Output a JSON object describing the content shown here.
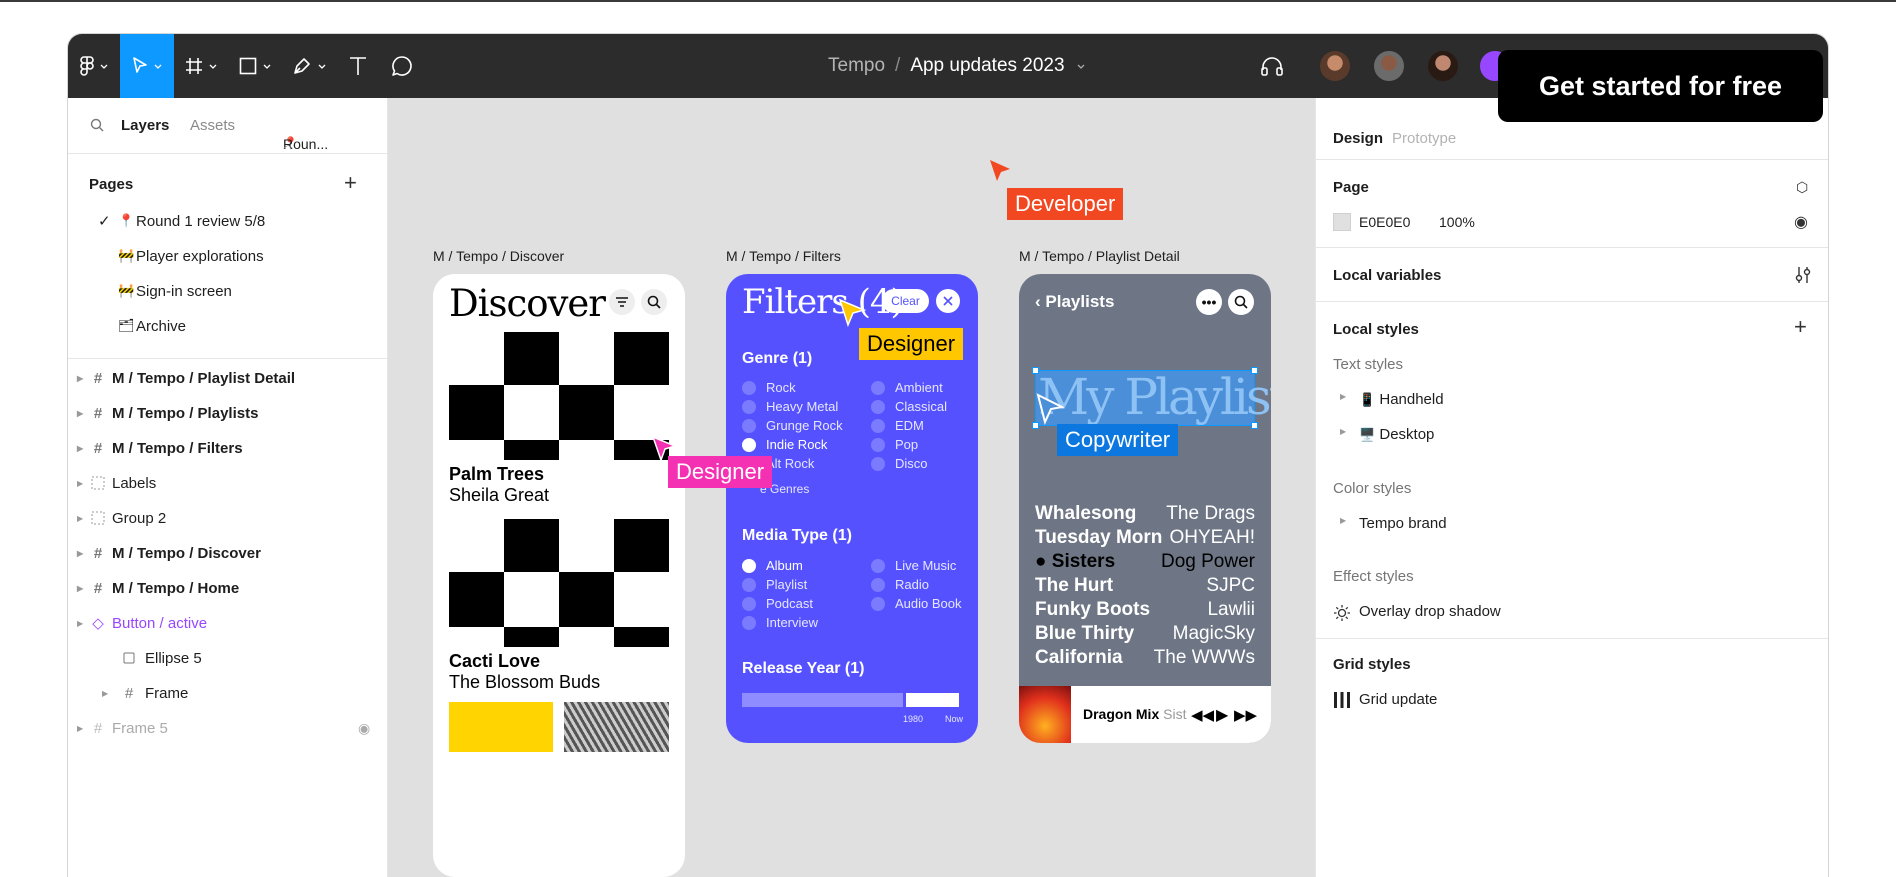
{
  "toolbar": {
    "breadcrumb_project": "Tempo",
    "breadcrumb_sep": "/",
    "breadcrumb_file": "App updates 2023"
  },
  "cta": "Get started for free",
  "left": {
    "tab_layers": "Layers",
    "tab_assets": "Assets",
    "current_page": "Roun...",
    "pages_title": "Pages",
    "pages": [
      {
        "emoji": "📍",
        "label": "Round 1 review 5/8",
        "checked": true
      },
      {
        "emoji": "🚧",
        "label": "Player explorations"
      },
      {
        "emoji": "🚧",
        "label": "Sign-in screen"
      },
      {
        "emoji": "🗂",
        "label": "Archive"
      }
    ],
    "layers": [
      {
        "label": "M / Tempo / Playlist Detail",
        "icon": "frame-icon"
      },
      {
        "label": "M / Tempo / Playlists",
        "icon": "frame-icon"
      },
      {
        "label": "M / Tempo / Filters",
        "icon": "frame-icon"
      },
      {
        "label": "Labels",
        "icon": "section-icon"
      },
      {
        "label": "Group 2",
        "icon": "section-icon"
      },
      {
        "label": "M / Tempo / Discover",
        "icon": "frame-icon"
      },
      {
        "label": "M / Tempo / Home",
        "icon": "frame-icon"
      },
      {
        "label": "Button / active",
        "icon": "component-icon"
      },
      {
        "label": "Ellipse 5",
        "icon": "rectangle-icon"
      },
      {
        "label": "Frame",
        "icon": "frame-icon"
      },
      {
        "label": "Frame 5",
        "icon": "frame-icon"
      }
    ]
  },
  "canvas": {
    "frame_labels": [
      "M / Tempo / Discover",
      "M / Tempo / Filters",
      "M / Tempo / Playlist Detail"
    ],
    "cursor_tags": {
      "developer": "Developer",
      "designer1": "Designer",
      "designer2": "Designer",
      "copywriter": "Copywriter"
    },
    "discover": {
      "title": "Discover",
      "card1_title": "Palm Trees",
      "card1_artist": "Sheila Great",
      "card2_title": "Cacti Love",
      "card2_artist": "The Blossom Buds"
    },
    "filters": {
      "title": "Filters (4)",
      "clear": "Clear",
      "genre_heading": "Genre (1)",
      "genres_left": [
        "Rock",
        "Heavy Metal",
        "Grunge Rock",
        "Indie Rock",
        "Alt Rock"
      ],
      "genres_right": [
        "Ambient",
        "Classical",
        "EDM",
        "Pop",
        "Disco"
      ],
      "more_genres": "e Genres",
      "media_heading": "Media Type (1)",
      "media_left": [
        "Album",
        "Playlist",
        "Podcast",
        "Interview"
      ],
      "media_right": [
        "Live Music",
        "Radio",
        "Audio Book"
      ],
      "release_heading": "Release Year (1)",
      "range_from": "1980",
      "range_to": "Now"
    },
    "playlist": {
      "back_label": "Playlists",
      "title": "My Playlist",
      "songs": [
        {
          "title": "Whalesong",
          "artist": "The Drags"
        },
        {
          "title": "Tuesday Morn",
          "artist": "OHYEAH!"
        },
        {
          "title": "Sisters",
          "artist": "Dog Power"
        },
        {
          "title": "The Hurt",
          "artist": "SJPC"
        },
        {
          "title": "Funky Boots",
          "artist": "Lawlii"
        },
        {
          "title": "Blue Thirty",
          "artist": "MagicSky"
        },
        {
          "title": "California",
          "artist": "The WWWs"
        }
      ],
      "now_playing": "Dragon Mix",
      "now_playing_artist": "Sist"
    }
  },
  "right": {
    "tab_design": "Design",
    "tab_prototype": "Prototype",
    "page_title": "Page",
    "page_color": "E0E0E0",
    "page_opacity": "100%",
    "local_variables": "Local variables",
    "local_styles": "Local styles",
    "text_styles": "Text styles",
    "text_style_items": [
      {
        "emoji": "📱",
        "label": "Handheld"
      },
      {
        "emoji": "🖥️",
        "label": "Desktop"
      }
    ],
    "color_styles": "Color styles",
    "color_style_item": "Tempo brand",
    "effect_styles": "Effect styles",
    "effect_style_item": "Overlay drop shadow",
    "grid_styles": "Grid styles",
    "grid_style_item": "Grid update"
  }
}
